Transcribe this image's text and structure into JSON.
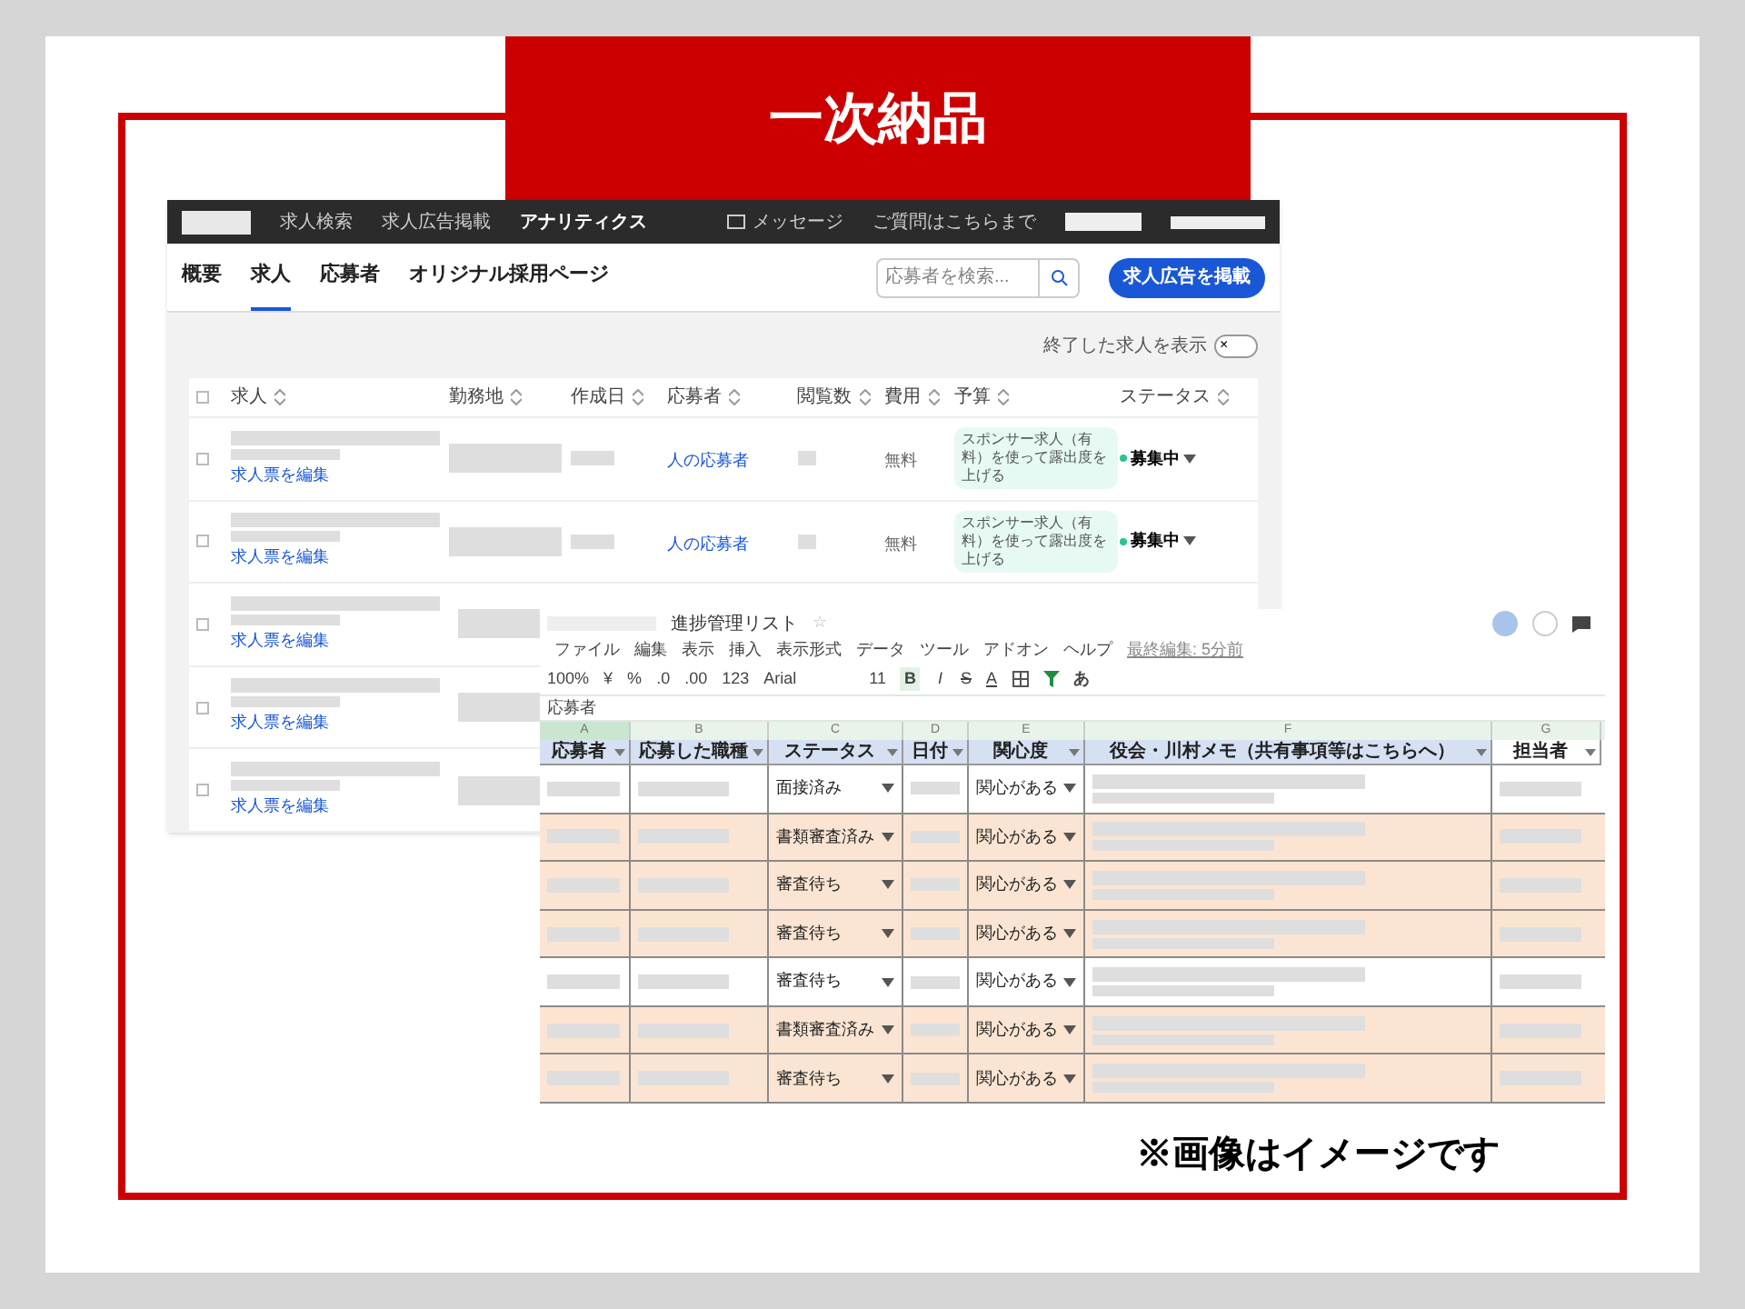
{
  "slide": {
    "title": "一次納品",
    "caption": "※画像はイメージです"
  },
  "job_site": {
    "nav": {
      "links": [
        "求人検索",
        "求人広告掲載",
        "アナリティクス"
      ],
      "messages": "メッセージ",
      "help": "ご質問はこちらまで"
    },
    "tabs": [
      {
        "label": "概要",
        "selected": false
      },
      {
        "label": "求人",
        "selected": true
      },
      {
        "label": "応募者",
        "selected": false
      },
      {
        "label": "オリジナル採用ページ",
        "selected": false
      }
    ],
    "search": {
      "placeholder": "応募者を検索..."
    },
    "post_button": "求人広告を掲載",
    "show_closed": {
      "label": "終了した求人を表示",
      "on": false,
      "icon": "×"
    },
    "select_all": {
      "checked": false
    },
    "columns": [
      "求人",
      "勤務地",
      "作成日",
      "応募者",
      "閲覧数",
      "費用",
      "予算",
      "ステータス"
    ],
    "rows": [
      {
        "checked": false,
        "edit": "求人票を編集",
        "applicants": "人の応募者",
        "cost": "無料",
        "promo": "スポンサー求人（有料）を使って露出度を上げる",
        "status": "募集中"
      },
      {
        "checked": false,
        "edit": "求人票を編集",
        "applicants": "人の応募者",
        "cost": "無料",
        "promo": "スポンサー求人（有料）を使って露出度を上げる",
        "status": "募集中"
      },
      {
        "checked": false,
        "edit": "求人票を編集"
      },
      {
        "checked": false,
        "edit": "求人票を編集"
      },
      {
        "checked": false,
        "edit": "求人票を編集"
      }
    ]
  },
  "sheet": {
    "title": "進捗管理リスト",
    "star": "☆",
    "menu": [
      "ファイル",
      "編集",
      "表示",
      "挿入",
      "表示形式",
      "データ",
      "ツール",
      "アドオン",
      "ヘルプ"
    ],
    "last_edit": "最終編集: 5分前",
    "toolbar": {
      "zoom": "100%",
      "currency": "¥",
      "percent": "%",
      "dec_less": ".0",
      "dec_more": ".00",
      "format": "123",
      "font": "Arial",
      "size": "11",
      "bold": "B",
      "italic": "I",
      "strike": "S",
      "text_color": "A",
      "input": "あ"
    },
    "cell_value": "応募者",
    "column_letters": [
      "A",
      "B",
      "C",
      "D",
      "E",
      "F",
      "G"
    ],
    "headers": [
      "応募者",
      "応募した職種",
      "ステータス",
      "日付",
      "関心度",
      "役会・川村メモ（共有事項等はこちらへ）",
      "担当者"
    ],
    "rows": [
      {
        "status": "面接済み",
        "interest": "関心がある",
        "highlighted": false
      },
      {
        "status": "書類審査済み",
        "interest": "関心がある",
        "highlighted": true
      },
      {
        "status": "審査待ち",
        "interest": "関心がある",
        "highlighted": true
      },
      {
        "status": "審査待ち",
        "interest": "関心がある",
        "highlighted": true
      },
      {
        "status": "審査待ち",
        "interest": "関心がある",
        "highlighted": false
      },
      {
        "status": "書類審査済み",
        "interest": "関心がある",
        "highlighted": true
      },
      {
        "status": "審査待ち",
        "interest": "関心がある",
        "highlighted": true
      }
    ]
  }
}
